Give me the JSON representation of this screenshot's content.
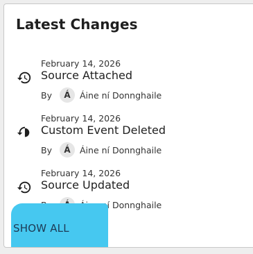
{
  "card": {
    "title": "Latest Changes",
    "entries": [
      {
        "date": "February 14, 2026",
        "action": "Source Attached",
        "by_label": "By",
        "avatar_initial": "Á",
        "author": "Áine ní Donnghaile",
        "icon": "history-icon"
      },
      {
        "date": "February 14, 2026",
        "action": "Custom Event Deleted",
        "by_label": "By",
        "avatar_initial": "Á",
        "author": "Áine ní Donnghaile",
        "icon": "history-icon"
      },
      {
        "date": "February 14, 2026",
        "action": "Source Updated",
        "by_label": "By",
        "avatar_initial": "Á",
        "author": "Áine ní Donnghaile",
        "icon": "history-icon"
      }
    ],
    "show_all_label": "SHOW ALL"
  },
  "colors": {
    "background": "#eeeeee",
    "card": "#ffffff",
    "annotation_highlight": "#46c8f0",
    "link": "#1d3a55"
  }
}
